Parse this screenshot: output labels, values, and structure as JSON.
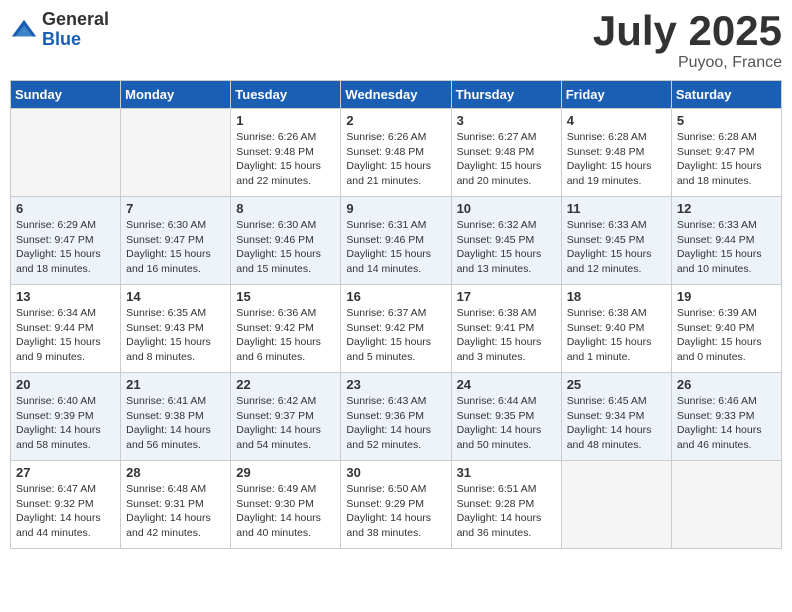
{
  "logo": {
    "general": "General",
    "blue": "Blue"
  },
  "title": "July 2025",
  "subtitle": "Puyoo, France",
  "days_of_week": [
    "Sunday",
    "Monday",
    "Tuesday",
    "Wednesday",
    "Thursday",
    "Friday",
    "Saturday"
  ],
  "weeks": [
    [
      {
        "day": "",
        "info": ""
      },
      {
        "day": "",
        "info": ""
      },
      {
        "day": "1",
        "info": "Sunrise: 6:26 AM\nSunset: 9:48 PM\nDaylight: 15 hours\nand 22 minutes."
      },
      {
        "day": "2",
        "info": "Sunrise: 6:26 AM\nSunset: 9:48 PM\nDaylight: 15 hours\nand 21 minutes."
      },
      {
        "day": "3",
        "info": "Sunrise: 6:27 AM\nSunset: 9:48 PM\nDaylight: 15 hours\nand 20 minutes."
      },
      {
        "day": "4",
        "info": "Sunrise: 6:28 AM\nSunset: 9:48 PM\nDaylight: 15 hours\nand 19 minutes."
      },
      {
        "day": "5",
        "info": "Sunrise: 6:28 AM\nSunset: 9:47 PM\nDaylight: 15 hours\nand 18 minutes."
      }
    ],
    [
      {
        "day": "6",
        "info": "Sunrise: 6:29 AM\nSunset: 9:47 PM\nDaylight: 15 hours\nand 18 minutes."
      },
      {
        "day": "7",
        "info": "Sunrise: 6:30 AM\nSunset: 9:47 PM\nDaylight: 15 hours\nand 16 minutes."
      },
      {
        "day": "8",
        "info": "Sunrise: 6:30 AM\nSunset: 9:46 PM\nDaylight: 15 hours\nand 15 minutes."
      },
      {
        "day": "9",
        "info": "Sunrise: 6:31 AM\nSunset: 9:46 PM\nDaylight: 15 hours\nand 14 minutes."
      },
      {
        "day": "10",
        "info": "Sunrise: 6:32 AM\nSunset: 9:45 PM\nDaylight: 15 hours\nand 13 minutes."
      },
      {
        "day": "11",
        "info": "Sunrise: 6:33 AM\nSunset: 9:45 PM\nDaylight: 15 hours\nand 12 minutes."
      },
      {
        "day": "12",
        "info": "Sunrise: 6:33 AM\nSunset: 9:44 PM\nDaylight: 15 hours\nand 10 minutes."
      }
    ],
    [
      {
        "day": "13",
        "info": "Sunrise: 6:34 AM\nSunset: 9:44 PM\nDaylight: 15 hours\nand 9 minutes."
      },
      {
        "day": "14",
        "info": "Sunrise: 6:35 AM\nSunset: 9:43 PM\nDaylight: 15 hours\nand 8 minutes."
      },
      {
        "day": "15",
        "info": "Sunrise: 6:36 AM\nSunset: 9:42 PM\nDaylight: 15 hours\nand 6 minutes."
      },
      {
        "day": "16",
        "info": "Sunrise: 6:37 AM\nSunset: 9:42 PM\nDaylight: 15 hours\nand 5 minutes."
      },
      {
        "day": "17",
        "info": "Sunrise: 6:38 AM\nSunset: 9:41 PM\nDaylight: 15 hours\nand 3 minutes."
      },
      {
        "day": "18",
        "info": "Sunrise: 6:38 AM\nSunset: 9:40 PM\nDaylight: 15 hours\nand 1 minute."
      },
      {
        "day": "19",
        "info": "Sunrise: 6:39 AM\nSunset: 9:40 PM\nDaylight: 15 hours\nand 0 minutes."
      }
    ],
    [
      {
        "day": "20",
        "info": "Sunrise: 6:40 AM\nSunset: 9:39 PM\nDaylight: 14 hours\nand 58 minutes."
      },
      {
        "day": "21",
        "info": "Sunrise: 6:41 AM\nSunset: 9:38 PM\nDaylight: 14 hours\nand 56 minutes."
      },
      {
        "day": "22",
        "info": "Sunrise: 6:42 AM\nSunset: 9:37 PM\nDaylight: 14 hours\nand 54 minutes."
      },
      {
        "day": "23",
        "info": "Sunrise: 6:43 AM\nSunset: 9:36 PM\nDaylight: 14 hours\nand 52 minutes."
      },
      {
        "day": "24",
        "info": "Sunrise: 6:44 AM\nSunset: 9:35 PM\nDaylight: 14 hours\nand 50 minutes."
      },
      {
        "day": "25",
        "info": "Sunrise: 6:45 AM\nSunset: 9:34 PM\nDaylight: 14 hours\nand 48 minutes."
      },
      {
        "day": "26",
        "info": "Sunrise: 6:46 AM\nSunset: 9:33 PM\nDaylight: 14 hours\nand 46 minutes."
      }
    ],
    [
      {
        "day": "27",
        "info": "Sunrise: 6:47 AM\nSunset: 9:32 PM\nDaylight: 14 hours\nand 44 minutes."
      },
      {
        "day": "28",
        "info": "Sunrise: 6:48 AM\nSunset: 9:31 PM\nDaylight: 14 hours\nand 42 minutes."
      },
      {
        "day": "29",
        "info": "Sunrise: 6:49 AM\nSunset: 9:30 PM\nDaylight: 14 hours\nand 40 minutes."
      },
      {
        "day": "30",
        "info": "Sunrise: 6:50 AM\nSunset: 9:29 PM\nDaylight: 14 hours\nand 38 minutes."
      },
      {
        "day": "31",
        "info": "Sunrise: 6:51 AM\nSunset: 9:28 PM\nDaylight: 14 hours\nand 36 minutes."
      },
      {
        "day": "",
        "info": ""
      },
      {
        "day": "",
        "info": ""
      }
    ]
  ]
}
